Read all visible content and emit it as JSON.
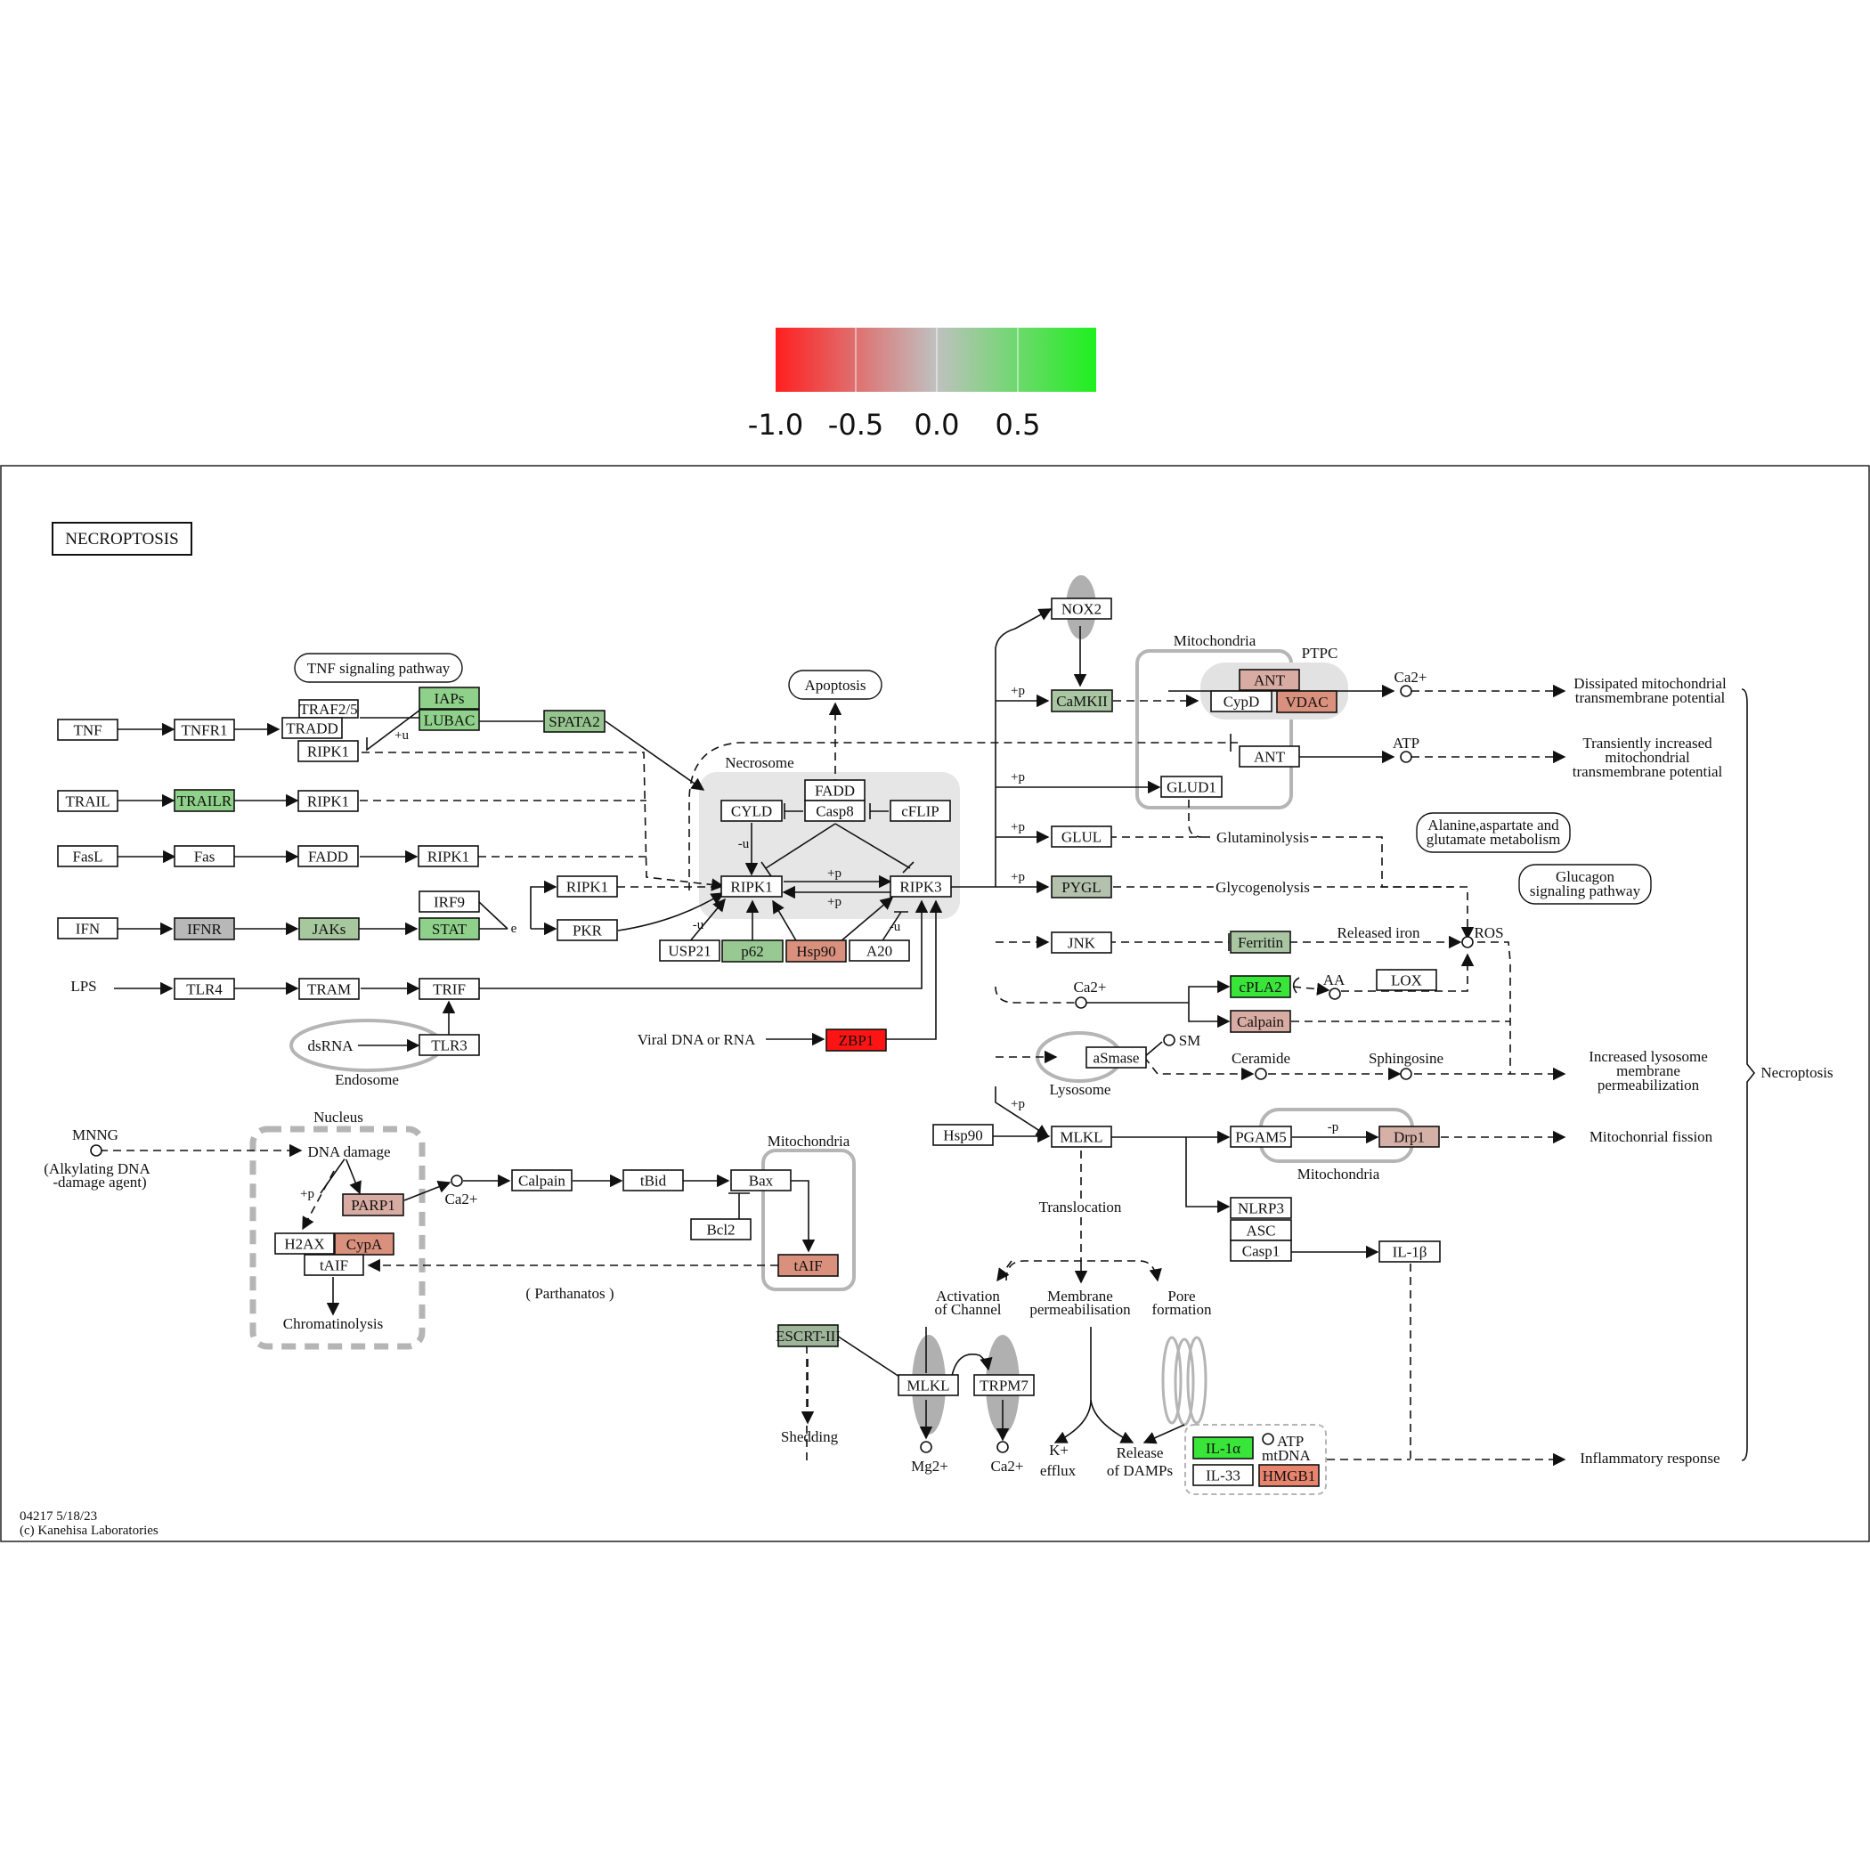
{
  "legend": {
    "ticks": [
      "-1.0",
      "-0.5",
      "0.0",
      "0.5"
    ],
    "colors": {
      "neg": "#ff2a2a",
      "mid": "#bdbdbd",
      "pos": "#25f025"
    }
  },
  "map": {
    "title": "NECROPTOSIS",
    "footer": {
      "id": "04217 5/18/23",
      "copyright": "(c) Kanehisa Laboratories"
    }
  },
  "nodes": [
    {
      "id": "tnf",
      "label": "TNF",
      "color": "#ffffff"
    },
    {
      "id": "tnfr1",
      "label": "TNFR1",
      "color": "#ffffff"
    },
    {
      "id": "traf25",
      "label": "TRAF2/5",
      "color": "#ffffff"
    },
    {
      "id": "tradd",
      "label": "TRADD",
      "color": "#ffffff"
    },
    {
      "id": "ripk1a",
      "label": "RIPK1",
      "color": "#ffffff"
    },
    {
      "id": "iaps",
      "label": "IAPs",
      "color": "#8fd18a"
    },
    {
      "id": "lubac",
      "label": "LUBAC",
      "color": "#8fd18a"
    },
    {
      "id": "spata2",
      "label": "SPATA2",
      "color": "#96c48f"
    },
    {
      "id": "trail",
      "label": "TRAIL",
      "color": "#ffffff"
    },
    {
      "id": "trailr",
      "label": "TRAILR",
      "color": "#8fd18a"
    },
    {
      "id": "ripk1b",
      "label": "RIPK1",
      "color": "#ffffff"
    },
    {
      "id": "fasl",
      "label": "FasL",
      "color": "#ffffff"
    },
    {
      "id": "fas",
      "label": "Fas",
      "color": "#ffffff"
    },
    {
      "id": "fadd1",
      "label": "FADD",
      "color": "#ffffff"
    },
    {
      "id": "ripk1c",
      "label": "RIPK1",
      "color": "#ffffff"
    },
    {
      "id": "ifn",
      "label": "IFN",
      "color": "#ffffff"
    },
    {
      "id": "ifnr",
      "label": "IFNR",
      "color": "#b8b8b8"
    },
    {
      "id": "jaks",
      "label": "JAKs",
      "color": "#a7c79f"
    },
    {
      "id": "stat",
      "label": "STAT",
      "color": "#8fd18a"
    },
    {
      "id": "irf9",
      "label": "IRF9",
      "color": "#ffffff"
    },
    {
      "id": "pkr",
      "label": "PKR",
      "color": "#ffffff"
    },
    {
      "id": "ripk1d",
      "label": "RIPK1",
      "color": "#ffffff"
    },
    {
      "id": "tlr4",
      "label": "TLR4",
      "color": "#ffffff"
    },
    {
      "id": "tram",
      "label": "TRAM",
      "color": "#ffffff"
    },
    {
      "id": "trif",
      "label": "TRIF",
      "color": "#ffffff"
    },
    {
      "id": "tlr3",
      "label": "TLR3",
      "color": "#ffffff"
    },
    {
      "id": "cyld",
      "label": "CYLD",
      "color": "#ffffff"
    },
    {
      "id": "fadd2",
      "label": "FADD",
      "color": "#ffffff"
    },
    {
      "id": "casp8",
      "label": "Casp8",
      "color": "#ffffff"
    },
    {
      "id": "cflip",
      "label": "cFLIP",
      "color": "#ffffff"
    },
    {
      "id": "ripk1m",
      "label": "RIPK1",
      "color": "#ffffff"
    },
    {
      "id": "ripk3",
      "label": "RIPK3",
      "color": "#ffffff"
    },
    {
      "id": "usp21",
      "label": "USP21",
      "color": "#ffffff"
    },
    {
      "id": "p62",
      "label": "p62",
      "color": "#99c992"
    },
    {
      "id": "hsp90a",
      "label": "Hsp90",
      "color": "#d9907c"
    },
    {
      "id": "a20",
      "label": "A20",
      "color": "#ffffff"
    },
    {
      "id": "zbp1",
      "label": "ZBP1",
      "color": "#ff1414"
    },
    {
      "id": "nox2",
      "label": "NOX2",
      "color": "#ffffff"
    },
    {
      "id": "camkii",
      "label": "CaMKII",
      "color": "#a9c5a2"
    },
    {
      "id": "ant1",
      "label": "ANT",
      "color": "#d8aca2"
    },
    {
      "id": "cypd",
      "label": "CypD",
      "color": "#ffffff"
    },
    {
      "id": "vdac",
      "label": "VDAC",
      "color": "#d9907c"
    },
    {
      "id": "ant2",
      "label": "ANT",
      "color": "#ffffff"
    },
    {
      "id": "glud1",
      "label": "GLUD1",
      "color": "#ffffff"
    },
    {
      "id": "glul",
      "label": "GLUL",
      "color": "#ffffff"
    },
    {
      "id": "pygl",
      "label": "PYGL",
      "color": "#b3c1ad"
    },
    {
      "id": "jnk",
      "label": "JNK",
      "color": "#ffffff"
    },
    {
      "id": "ferritin",
      "label": "Ferritin",
      "color": "#a9c5a2"
    },
    {
      "id": "cpla2",
      "label": "cPLA2",
      "color": "#3ae53a"
    },
    {
      "id": "lox",
      "label": "LOX",
      "color": "#ffffff"
    },
    {
      "id": "calpain1",
      "label": "Calpain",
      "color": "#d8aca2"
    },
    {
      "id": "asmase",
      "label": "aSmase",
      "color": "#ffffff"
    },
    {
      "id": "hsp90b",
      "label": "Hsp90",
      "color": "#ffffff"
    },
    {
      "id": "mlkl1",
      "label": "MLKL",
      "color": "#ffffff"
    },
    {
      "id": "pgam5",
      "label": "PGAM5",
      "color": "#ffffff"
    },
    {
      "id": "drp1",
      "label": "Drp1",
      "color": "#d5b0a6"
    },
    {
      "id": "nlrp3",
      "label": "NLRP3",
      "color": "#ffffff"
    },
    {
      "id": "asc",
      "label": "ASC",
      "color": "#ffffff"
    },
    {
      "id": "casp1",
      "label": "Casp1",
      "color": "#ffffff"
    },
    {
      "id": "il1b",
      "label": "IL-1β",
      "color": "#ffffff"
    },
    {
      "id": "parp1",
      "label": "PARP1",
      "color": "#d8aca2"
    },
    {
      "id": "h2ax",
      "label": "H2AX",
      "color": "#ffffff"
    },
    {
      "id": "cypa",
      "label": "CypA",
      "color": "#d9907c"
    },
    {
      "id": "taif1",
      "label": "tAIF",
      "color": "#ffffff"
    },
    {
      "id": "calpain2",
      "label": "Calpain",
      "color": "#ffffff"
    },
    {
      "id": "tbid",
      "label": "tBid",
      "color": "#ffffff"
    },
    {
      "id": "bax",
      "label": "Bax",
      "color": "#ffffff"
    },
    {
      "id": "bcl2",
      "label": "Bcl2",
      "color": "#ffffff"
    },
    {
      "id": "taif2",
      "label": "tAIF",
      "color": "#d9907c"
    },
    {
      "id": "escrt",
      "label": "ESCRT-III",
      "color": "#9fb59a"
    },
    {
      "id": "mlkl2",
      "label": "MLKL",
      "color": "#ffffff"
    },
    {
      "id": "trpm7",
      "label": "TRPM7",
      "color": "#ffffff"
    },
    {
      "id": "il1a",
      "label": "IL-1α",
      "color": "#3ae53a"
    },
    {
      "id": "il33",
      "label": "IL-33",
      "color": "#ffffff"
    },
    {
      "id": "hmgb1",
      "label": "HMGB1",
      "color": "#e8846d"
    }
  ],
  "labels": {
    "tnf_pathway": "TNF signaling  pathway",
    "apoptosis": "Apoptosis",
    "necrosome": "Necrosome",
    "mito_top": "Mitochondria",
    "ptpc": "PTPC",
    "ca_top": "Ca2+",
    "atp_top": "ATP",
    "dissipated": [
      "Dissipated mitochondrial",
      "transmembrane potential"
    ],
    "transient": [
      "Transiently increased",
      "mitochondrial",
      "transmembrane potential"
    ],
    "alanine": [
      "Alanine,aspartate and",
      "glutamate metabolism"
    ],
    "glucagon": [
      "Glucagon",
      "signaling pathway"
    ],
    "glutaminolysis": "Glutaminolysis",
    "glycogenolysis": "Glycogenolysis",
    "released_iron": "Released iron",
    "ros": "ROS",
    "aa": "AA",
    "ca_mid": "Ca2+",
    "sm": "SM",
    "ceramide": "Ceramide",
    "sphingosine": "Sphingosine",
    "lysosome": "Lysosome",
    "increased_lyso": [
      "Increased lysosome",
      "membrane",
      "permeabilization"
    ],
    "necroptosis": "Necroptosis",
    "mito_fission": "Mitochonrial fission",
    "mito_drp": "Mitochondria",
    "translocation": "Translocation",
    "activation": [
      "Activation",
      "of Channel"
    ],
    "membrane_perm": [
      "Membrane",
      "permeabilisation"
    ],
    "pore": [
      "Pore",
      "formation"
    ],
    "shedding": "Shedding",
    "mg": "Mg2+",
    "ca_bottom": "Ca2+",
    "k_efflux": [
      "K+",
      "efflux"
    ],
    "damps": [
      "Release",
      "of DAMPs"
    ],
    "atp_bottom": "ATP",
    "mtdna": "mtDNA",
    "inflammatory": "Inflammatory response",
    "lps": "LPS",
    "dsrna": "dsRNA",
    "endosome": "Endosome",
    "viral": "Viral DNA or RNA",
    "nucleus": "Nucleus",
    "mnng": "MNNG",
    "alkylating": [
      "(Alkylating DNA",
      "-damage agent)"
    ],
    "dna_damage": "DNA damage",
    "ca_nuc": "Ca2+",
    "chromatinolysis": "Chromatinolysis",
    "parthanatos": "( Parthanatos )",
    "mito_bax": "Mitochondria",
    "plus_u": "+u",
    "minus_u1": "-u",
    "minus_u2": "-u",
    "minus_u3": "-u",
    "plus_p_a": "+p",
    "plus_p_b": "+p",
    "plus_p_camk": "+p",
    "plus_p_glud": "+p",
    "plus_p_glul": "+p",
    "plus_p_pygl": "+p",
    "plus_p_mlkl": "+p",
    "minus_p": "-p",
    "plus_p_nuc": "+p",
    "e": "e"
  }
}
